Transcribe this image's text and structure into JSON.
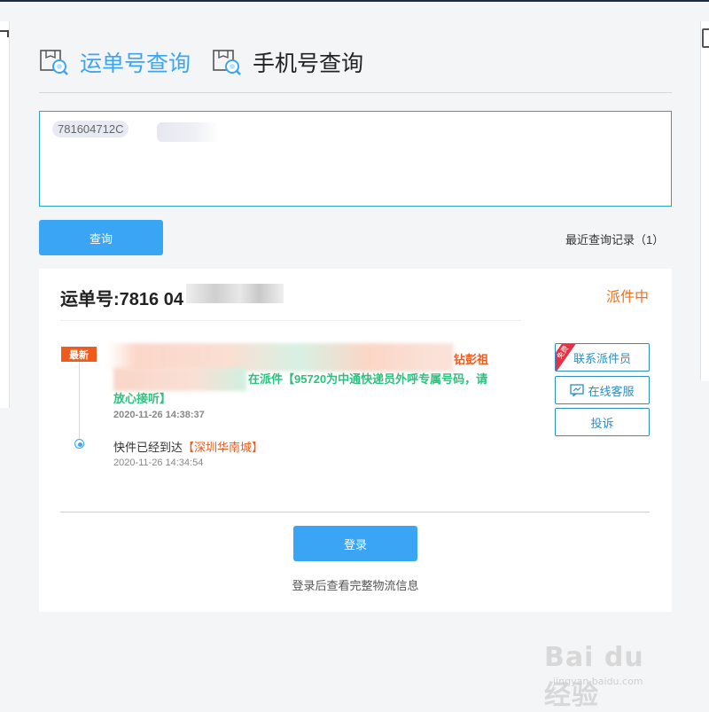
{
  "tabs": [
    {
      "label": "运单号查询",
      "icon": "package-search-icon",
      "active": true
    },
    {
      "label": "手机号查询",
      "icon": "package-search-icon",
      "active": false
    }
  ],
  "search": {
    "value": "781604712C"
  },
  "query_button": "查询",
  "history_link": "最近查询记录（1）",
  "result": {
    "waybill_label": "运单号:7816 04",
    "status": "派件中",
    "latest_badge": "最新",
    "events": [
      {
        "text_tail": "钻彭祖",
        "text_line2": "在派件【95720为中通快递员外呼专属号码，请",
        "text_line3": "放心接听】",
        "time": "2020-11-26 14:38:37"
      },
      {
        "text": "快件已经到达",
        "location": "【深圳华南城】",
        "time": "2020-11-26 14:34:54"
      }
    ],
    "actions": {
      "contact": "联系派件员",
      "free_tag": "免费",
      "chat": "在线客服",
      "complain": "投诉"
    },
    "login_button": "登录",
    "login_hint": "登录后查看完整物流信息"
  },
  "watermark": {
    "text": "Bai du 经验",
    "url": "jingyan.baidu.com"
  },
  "colors": {
    "accent": "#3ba5f5",
    "status": "#f0701d",
    "highlight_green": "#2ec07e",
    "badge": "#f05a1a"
  }
}
